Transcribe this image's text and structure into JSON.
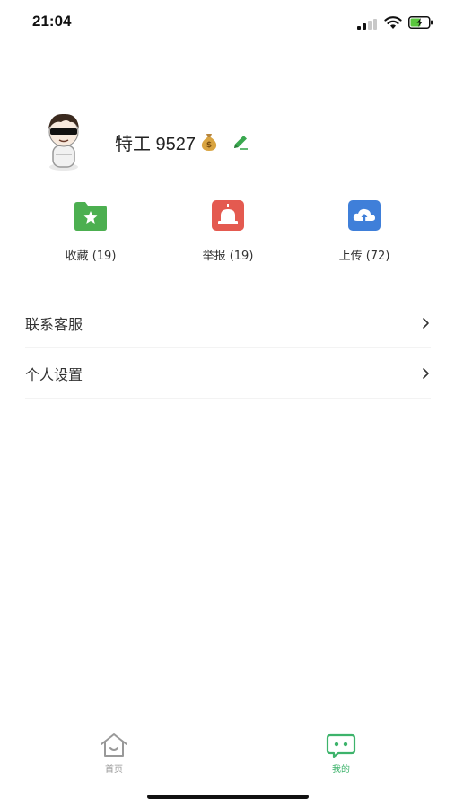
{
  "status": {
    "time": "21:04"
  },
  "profile": {
    "username": "特工 9527"
  },
  "actions": [
    {
      "label": "收藏 (19)",
      "icon": "folder-star-icon",
      "color": "#4caf50"
    },
    {
      "label": "举报 (19)",
      "icon": "alarm-icon",
      "color": "#e45a50"
    },
    {
      "label": "上传 (72)",
      "icon": "cloud-upload-icon",
      "color": "#3f7fd9"
    }
  ],
  "menu": [
    {
      "label": "联系客服"
    },
    {
      "label": "个人设置"
    }
  ],
  "tabbar": {
    "items": [
      {
        "label": "首页",
        "icon": "home-icon",
        "color": "#999999"
      },
      {
        "label": "我的",
        "icon": "smiley-chat-icon",
        "color": "#3db36b",
        "active": true
      }
    ]
  },
  "colors": {
    "accent": "#3db36b",
    "edit": "#3aa84f"
  }
}
